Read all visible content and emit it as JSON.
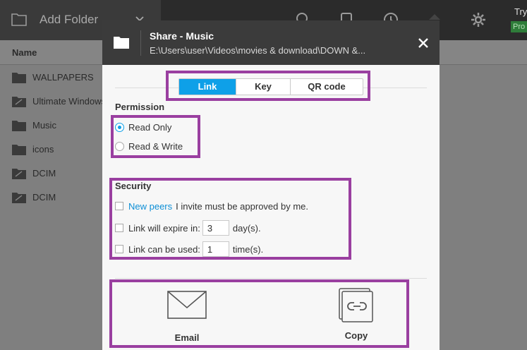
{
  "app": {
    "add_folder_label": "Add Folder",
    "try_label": "Try",
    "pro_label": "Pro",
    "list_header": "Name",
    "items": [
      {
        "name": "WALLPAPERS",
        "icon": "folder-icon"
      },
      {
        "name": "Ultimate Windows",
        "icon": "folder-sync-icon"
      },
      {
        "name": "Music",
        "icon": "folder-icon"
      },
      {
        "name": "icons",
        "icon": "folder-icon"
      },
      {
        "name": "DCIM",
        "icon": "folder-sync-icon"
      },
      {
        "name": "DCIM",
        "icon": "folder-sync-icon"
      }
    ]
  },
  "dialog": {
    "title": "Share - Music",
    "path": "E:\\Users\\user\\Videos\\movies & download\\DOWN &...",
    "tabs": [
      {
        "label": "Link",
        "active": true
      },
      {
        "label": "Key",
        "active": false
      },
      {
        "label": "QR code",
        "active": false
      }
    ],
    "permission": {
      "title": "Permission",
      "options": [
        {
          "label": "Read Only",
          "checked": true
        },
        {
          "label": "Read & Write",
          "checked": false
        }
      ]
    },
    "security": {
      "title": "Security",
      "approval_link": "New peers",
      "approval_text": "I invite must be approved by me.",
      "expire_label": "Link will expire in:",
      "expire_value": "3",
      "expire_unit": "day(s).",
      "uses_label": "Link can be used:",
      "uses_value": "1",
      "uses_unit": "time(s)."
    },
    "share_options": [
      {
        "label": "Email",
        "icon": "envelope-icon"
      },
      {
        "label": "Copy",
        "icon": "copy-link-icon"
      }
    ]
  },
  "colors": {
    "accent": "#0ea0e8",
    "highlight": "#9a3fa0",
    "header": "#3b3b3b"
  }
}
